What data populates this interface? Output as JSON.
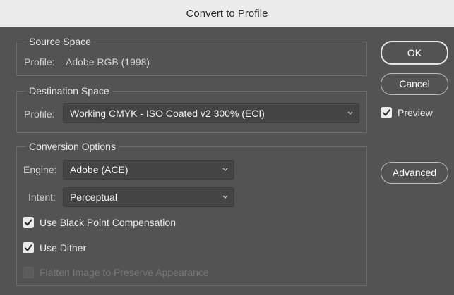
{
  "window": {
    "title": "Convert to Profile"
  },
  "source_space": {
    "title": "Source Space",
    "profile_label": "Profile:",
    "profile_value": "Adobe RGB (1998)"
  },
  "destination_space": {
    "title": "Destination Space",
    "profile_label": "Profile:",
    "profile_selected": "Working CMYK - ISO Coated v2 300% (ECI)"
  },
  "conversion_options": {
    "title": "Conversion Options",
    "engine_label": "Engine:",
    "engine_selected": "Adobe (ACE)",
    "intent_label": "Intent:",
    "intent_selected": "Perceptual",
    "black_point": {
      "label": "Use Black Point Compensation",
      "checked": true
    },
    "dither": {
      "label": "Use Dither",
      "checked": true
    },
    "flatten": {
      "label": "Flatten Image to Preserve Appearance",
      "checked": false,
      "enabled": false
    }
  },
  "buttons": {
    "ok": "OK",
    "cancel": "Cancel",
    "advanced": "Advanced"
  },
  "preview": {
    "label": "Preview",
    "checked": true
  },
  "colors": {
    "panel_bg": "#535353",
    "titlebar_bg": "#ececec",
    "field_bg": "#444444"
  },
  "icons": {
    "select_arrow": "chevron-down-icon",
    "checkbox_mark": "checkmark-icon"
  }
}
